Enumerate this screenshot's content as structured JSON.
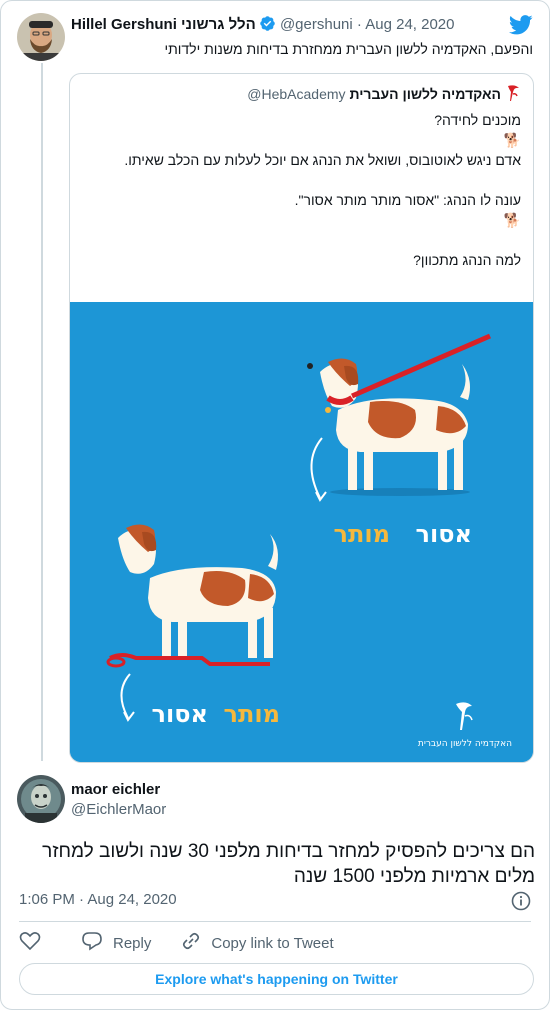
{
  "tweet1": {
    "author_name": "Hillel Gershuni הלל גרשוני",
    "handle": "@gershuni",
    "date": "· Aug 24, 2020",
    "text": "והפעם, האקדמיה ללשון העברית ממחזרת בדיחות משנות ילדותי"
  },
  "quoted": {
    "author_name": "האקדמיה ללשון העברית",
    "handle": "@HebAcademy",
    "lines": [
      "מוכנים לחידה?",
      "🐕",
      "אדם ניגש לאוטובוס, ושואל את הנהג אם יוכל לעלות עם הכלב שאיתו.",
      "",
      "עונה לו הנהג: \"אסור מותר מותר אסור\".",
      "🐕",
      "",
      "למה הנהג מתכוון?"
    ],
    "image": {
      "label_top_white": "אסור",
      "label_top_yellow": "מותר",
      "label_bottom_yellow": "מותר",
      "label_bottom_white": "אסור",
      "brand": "האקדמיה ללשון העברית",
      "background": "#1d96d6",
      "accent_yellow": "#f5b83d",
      "leash_red": "#d92127"
    }
  },
  "tweet2": {
    "author_name": "maor eichler",
    "handle": "@EichlerMaor",
    "text": "הם צריכים להפסיק למחזר בדיחות מלפני 30 שנה ולשוב למחזר מלים ארמיות מלפני 1500 שנה",
    "time": "1:06 PM · Aug 24, 2020"
  },
  "actions": {
    "reply": "Reply",
    "copy_link": "Copy link to Tweet"
  },
  "explore_label": "Explore what's happening on Twitter",
  "colors": {
    "twitter_blue": "#1d9bf0",
    "muted": "#536471",
    "border": "#cfd9de"
  }
}
